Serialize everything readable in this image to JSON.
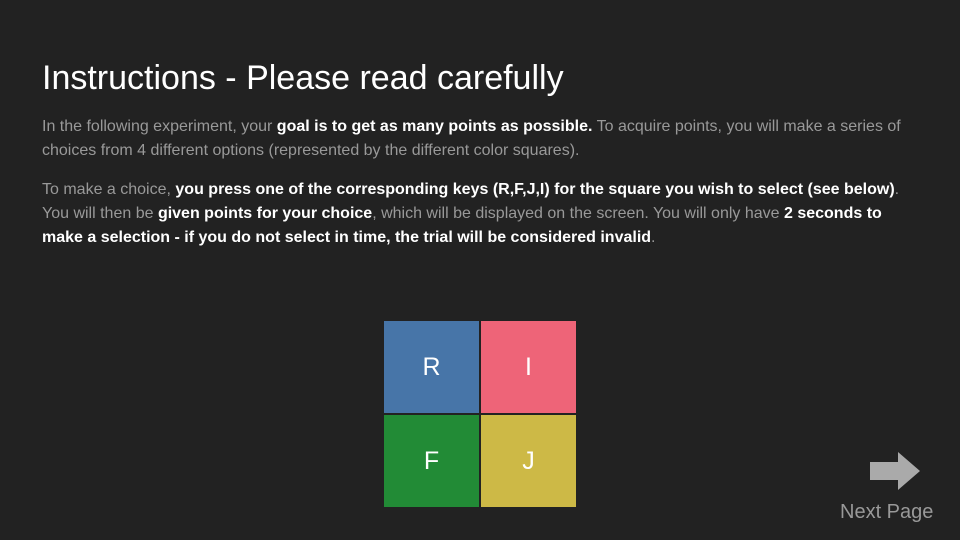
{
  "title": "Instructions - Please read carefully",
  "paragraph1": {
    "t1": "In the following experiment, your ",
    "b1": "goal is to get as many points as possible.",
    "t2": " To acquire points, you will make a series of choices from 4 different options (represented by the different color squares)."
  },
  "paragraph2": {
    "t1": "To make a choice, ",
    "b1": "you press one of the corresponding keys (R,F,J,I) for the square you wish to select (see below)",
    "t2": ". You will then be ",
    "b2": "given points for your choice",
    "t3": ", which will be displayed on the screen. You will only have ",
    "b3": "2 seconds to make a selection - if you do not select in time, the trial will be considered invalid",
    "t4": "."
  },
  "squares": [
    {
      "key": "R",
      "color": "#4775a8"
    },
    {
      "key": "I",
      "color": "#ee6478"
    },
    {
      "key": "F",
      "color": "#228b36"
    },
    {
      "key": "J",
      "color": "#cdb946"
    }
  ],
  "next": {
    "label": "Next Page",
    "icon": "right-arrow-icon",
    "color": "#999999"
  },
  "colors": {
    "background": "#222222",
    "title": "#ffffff",
    "body_text": "#999999",
    "emphasis": "#ffffff"
  }
}
